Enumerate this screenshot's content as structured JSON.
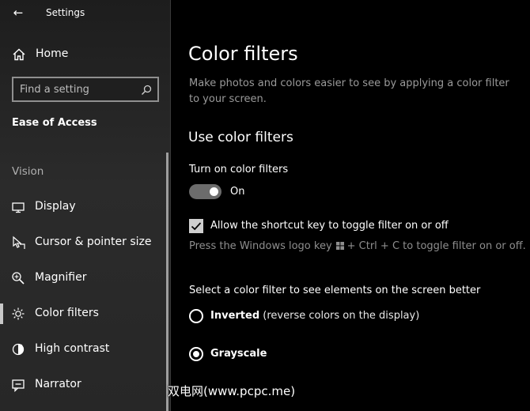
{
  "app": {
    "title": "Settings",
    "back_glyph": "←"
  },
  "sidebar": {
    "home_label": "Home",
    "search_placeholder": "Find a setting",
    "section_title": "Ease of Access",
    "group_label": "Vision",
    "items": [
      {
        "label": "Display",
        "icon": "monitor-icon",
        "selected": false
      },
      {
        "label": "Cursor & pointer size",
        "icon": "cursor-icon",
        "selected": false
      },
      {
        "label": "Magnifier",
        "icon": "magnifier-icon",
        "selected": false
      },
      {
        "label": "Color filters",
        "icon": "sun-icon",
        "selected": true
      },
      {
        "label": "High contrast",
        "icon": "contrast-icon",
        "selected": false
      },
      {
        "label": "Narrator",
        "icon": "narrator-icon",
        "selected": false
      }
    ]
  },
  "main": {
    "title": "Color filters",
    "description": "Make photos and colors easier to see by applying a color filter to your screen.",
    "section_heading": "Use color filters",
    "toggle": {
      "label": "Turn on color filters",
      "state_text": "On",
      "on": true
    },
    "shortcut_checkbox": {
      "label": "Allow the shortcut key to toggle filter on or off",
      "checked": true
    },
    "hint": {
      "before": "Press the Windows logo key",
      "after": "+ Ctrl + C to toggle filter on or off."
    },
    "filter_select_label": "Select a color filter to see elements on the screen better",
    "filters": [
      {
        "name": "Inverted",
        "description": "(reverse colors on the display)",
        "checked": false
      },
      {
        "name": "Grayscale",
        "description": "",
        "checked": true
      }
    ]
  },
  "watermark": "双电网(www.pcpc.me)"
}
